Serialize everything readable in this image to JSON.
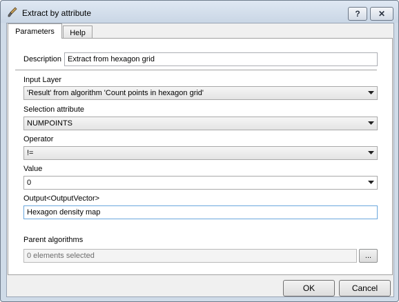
{
  "window": {
    "title": "Extract by attribute",
    "help_button": "?",
    "close_button": "✕"
  },
  "tabs": [
    {
      "label": "Parameters",
      "active": true
    },
    {
      "label": "Help",
      "active": false
    }
  ],
  "form": {
    "description": {
      "label": "Description",
      "value": "Extract from hexagon grid"
    },
    "input_layer": {
      "label": "Input Layer",
      "value": "'Result' from algorithm 'Count points in hexagon grid'"
    },
    "selection_attribute": {
      "label": "Selection attribute",
      "value": "NUMPOINTS"
    },
    "operator": {
      "label": "Operator",
      "value": "!="
    },
    "value": {
      "label": "Value",
      "value": "0"
    },
    "output": {
      "label": "Output<OutputVector>",
      "value": "Hexagon density map"
    },
    "parent_algorithms": {
      "label": "Parent algorithms",
      "value": "0 elements selected",
      "button": "..."
    }
  },
  "buttons": {
    "ok": "OK",
    "cancel": "Cancel"
  },
  "icons": {
    "title": "brush-icon",
    "dropdown": "chevron-down-icon"
  }
}
